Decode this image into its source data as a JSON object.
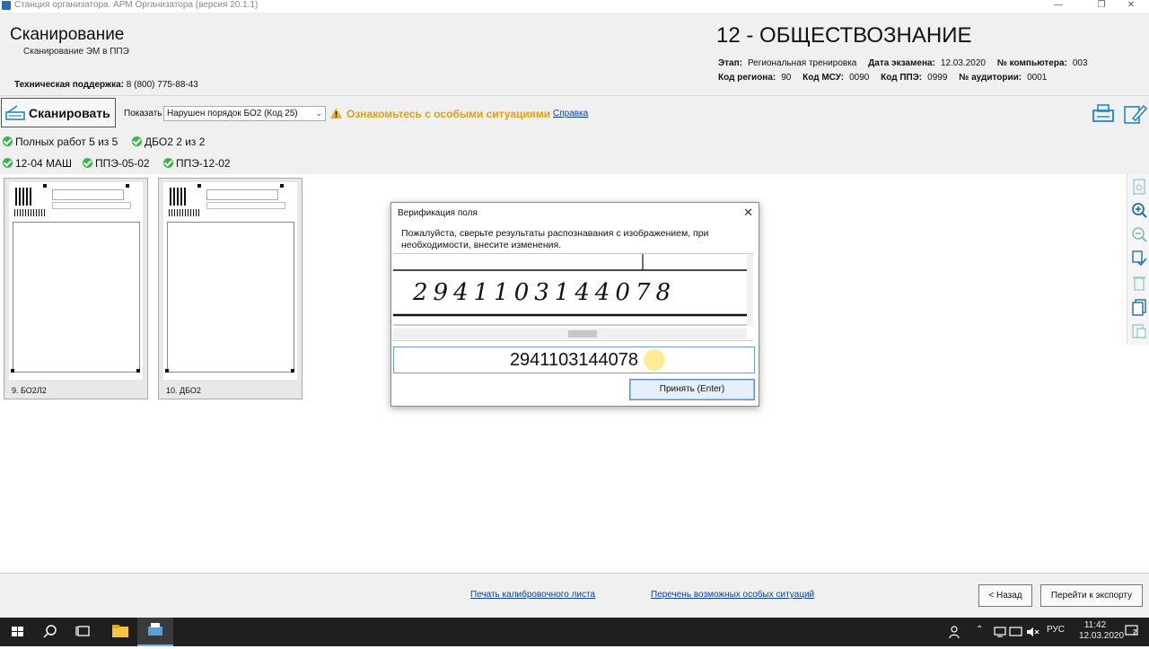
{
  "window": {
    "title": "Станция организатора. АРМ Организатора (версия 20.1.1)",
    "minimize_icon": "minimize-icon",
    "restore_icon": "restore-icon",
    "close_icon": "close-icon"
  },
  "header": {
    "title": "Сканирование",
    "subtitle": "Сканирование ЭМ в ППЭ",
    "support_label": "Техническая поддержка:",
    "support_phone": "8 (800) 775-88-43",
    "subject": "12 - ОБЩЕСТВОЗНАНИЕ",
    "info_row1": [
      {
        "label": "Этап:",
        "value": "Региональная тренировка"
      },
      {
        "label": "Дата экзамена:",
        "value": "12.03.2020"
      },
      {
        "label": "№ компьютера:",
        "value": "003"
      }
    ],
    "info_row2": [
      {
        "label": "Код региона:",
        "value": "90"
      },
      {
        "label": "Код МСУ:",
        "value": "0090"
      },
      {
        "label": "Код ППЭ:",
        "value": "0999"
      },
      {
        "label": "№ аудитории:",
        "value": "0001"
      }
    ]
  },
  "toolbar": {
    "scan_label": "Сканировать",
    "show_label": "Показать",
    "filter_value": "Нарушен порядок БО2 (Код 25)",
    "warning_text": "Ознакомьтесь с особыми ситуациями",
    "help_link": "Справка"
  },
  "status": {
    "row1": [
      "Полных работ 5 из 5",
      "ДБО2 2 из 2"
    ],
    "row2": [
      "12-04 МАШ",
      "ППЭ-05-02",
      "ППЭ-12-02"
    ]
  },
  "cards": [
    {
      "caption": "9. БО2Л2"
    },
    {
      "caption": "10. ДБО2"
    }
  ],
  "dialog": {
    "title": "Верификация поля",
    "message": "Пожалуйста, сверьте результаты распознавания с изображением, при необходимости, внесите изменения.",
    "handwriting": "2941103144078",
    "field_value": "2941103144078",
    "accept_label": "Принять (Enter)"
  },
  "footer": {
    "print_link": "Печать калибровочного листа",
    "situations_link": "Перечень возможных особых ситуаций",
    "back_label": "< Назад",
    "export_label": "Перейти к экспорту"
  },
  "taskbar": {
    "lang": "РУС",
    "time": "11:42",
    "date": "12.03.2020",
    "notifications": "2"
  },
  "colors": {
    "warning": "#e5a00d",
    "check": "#3bb54a",
    "link": "#0b3fa8",
    "accent": "#1e88c8"
  }
}
